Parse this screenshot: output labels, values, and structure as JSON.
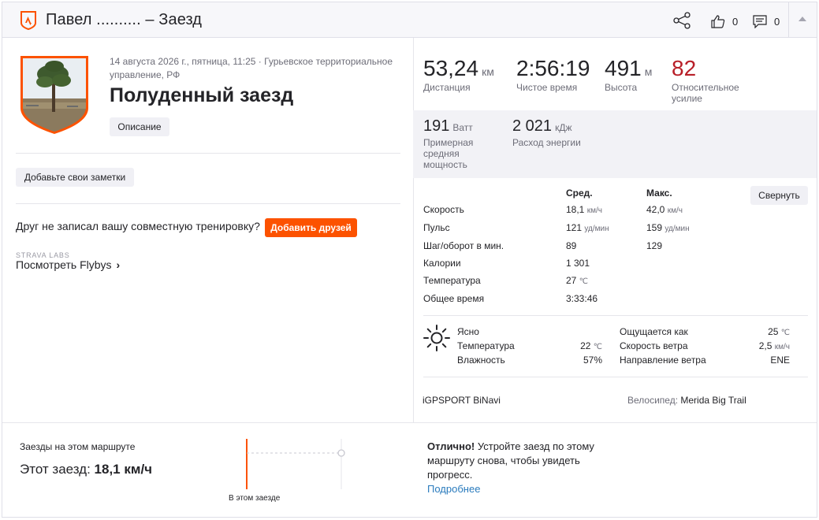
{
  "header": {
    "title": "Павел .......... – Заезд",
    "kudos_count": "0",
    "comments_count": "0",
    "icons": [
      "strava-logo-icon",
      "share-icon",
      "thumbs-up-icon",
      "comment-icon",
      "chevron-up-icon"
    ]
  },
  "activity": {
    "datetime": "14 августа 2026 г., пятница, 11:25",
    "location": "Гурьевское территориальное управление, РФ",
    "title": "Полуденный заезд",
    "description_button": "Описание",
    "notes_button": "Добавьте свои заметки",
    "friend_prompt": "Друг не записал вашу совместную тренировку?",
    "add_friends_button": "Добавить друзей",
    "labs_label": "STRAVA LABS",
    "flybys_prefix": "Посмотреть",
    "flybys_name": "Flybys"
  },
  "primary_stats": [
    {
      "value": "53,24",
      "unit": "км",
      "label": "Дистанция"
    },
    {
      "value": "2:56:19",
      "unit": "",
      "label": "Чистое время"
    },
    {
      "value": "491",
      "unit": "м",
      "label": "Высота"
    },
    {
      "value": "82",
      "unit": "",
      "label": "Относительное усилие"
    }
  ],
  "secondary_stats": [
    {
      "value": "191",
      "unit": "Ватт",
      "label": "Примерная средняя мощность"
    },
    {
      "value": "2 021",
      "unit": "кДж",
      "label": "Расход энергии"
    }
  ],
  "details": {
    "header_avg": "Сред.",
    "header_max": "Макс.",
    "collapse_button": "Свернуть",
    "rows": [
      {
        "label": "Скорость",
        "avg": "18,1",
        "avg_unit": "км/ч",
        "max": "42,0",
        "max_unit": "км/ч"
      },
      {
        "label": "Пульс",
        "avg": "121",
        "avg_unit": "уд/мин",
        "max": "159",
        "max_unit": "уд/мин"
      },
      {
        "label": "Шаг/оборот в мин.",
        "avg": "89",
        "avg_unit": "",
        "max": "129",
        "max_unit": ""
      },
      {
        "label": "Калории",
        "avg": "1 301",
        "avg_unit": "",
        "max": "",
        "max_unit": ""
      },
      {
        "label": "Температура",
        "avg": "27",
        "avg_unit": "℃",
        "max": "",
        "max_unit": ""
      },
      {
        "label": "Общее время",
        "avg": "3:33:46",
        "avg_unit": "",
        "max": "",
        "max_unit": ""
      }
    ]
  },
  "weather": {
    "condition": "Ясно",
    "temp_label": "Температура",
    "temp_value": "22",
    "temp_unit": "℃",
    "humidity_label": "Влажность",
    "humidity_value": "57%",
    "feels_label": "Ощущается как",
    "feels_value": "25",
    "feels_unit": "℃",
    "wind_speed_label": "Скорость ветра",
    "wind_speed_value": "2,5",
    "wind_speed_unit": "км/ч",
    "wind_dir_label": "Направление ветра",
    "wind_dir_value": "ENE"
  },
  "equipment": {
    "device": "iGPSPORT BiNavi",
    "bike_label": "Велосипед:",
    "bike_name": "Merida Big Trail"
  },
  "route": {
    "label": "Заезды на этом маршруте",
    "this_ride_label": "Этот заезд:",
    "this_ride_value": "18,1 км/ч",
    "chart_caption": "В этом заезде",
    "promo_bold": "Отлично!",
    "promo_text": "Устройте заезд по этому маршруту снова, чтобы увидеть прогресс.",
    "promo_link": "Подробнее"
  },
  "colors": {
    "brand_orange": "#fc5200",
    "effort_red": "#b81f28",
    "link_blue": "#2a7bbd"
  }
}
